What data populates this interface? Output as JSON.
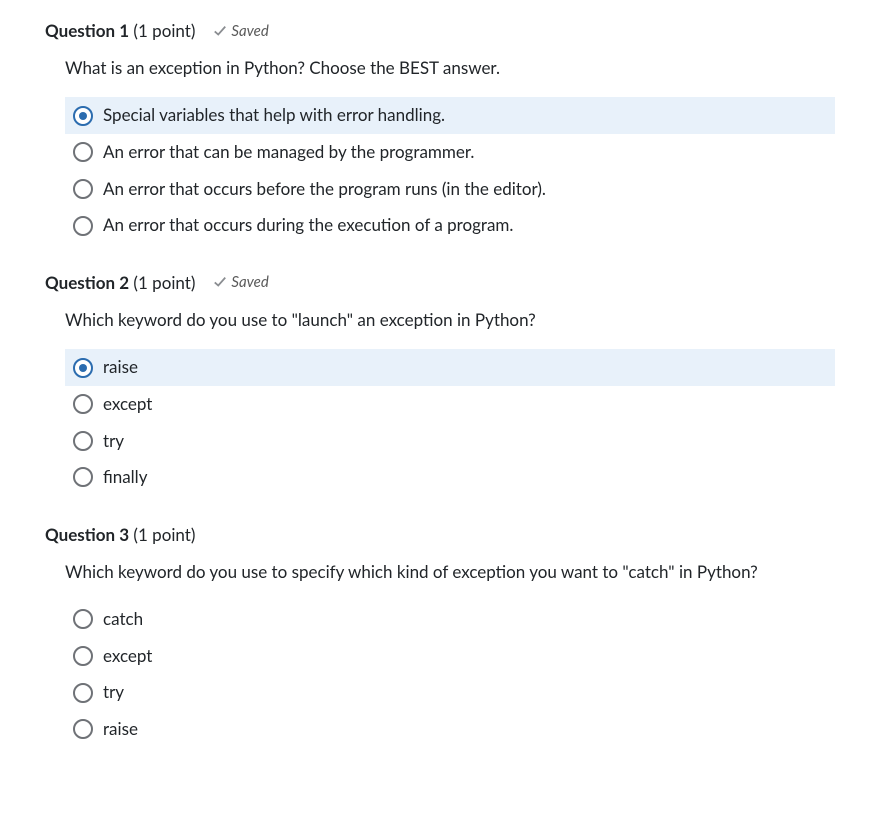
{
  "saved_label": "Saved",
  "questions": [
    {
      "number_label": "Question 1",
      "points_label": "(1 point)",
      "saved": true,
      "prompt": "What is an exception in Python? Choose the BEST answer.",
      "options": [
        {
          "label": "Special variables that help with error handling.",
          "selected": true
        },
        {
          "label": "An error that can be managed by the programmer.",
          "selected": false
        },
        {
          "label": "An error that occurs before the program runs (in the editor).",
          "selected": false
        },
        {
          "label": "An error that occurs during the execution of a program.",
          "selected": false
        }
      ]
    },
    {
      "number_label": "Question 2",
      "points_label": "(1 point)",
      "saved": true,
      "prompt": "Which keyword do you use to \"launch\" an exception in Python?",
      "options": [
        {
          "label": "raise",
          "selected": true
        },
        {
          "label": "except",
          "selected": false
        },
        {
          "label": "try",
          "selected": false
        },
        {
          "label": "finally",
          "selected": false
        }
      ]
    },
    {
      "number_label": "Question 3",
      "points_label": "(1 point)",
      "saved": false,
      "prompt": "Which keyword do you use to specify which kind of exception you want to \"catch\" in Python?",
      "options": [
        {
          "label": "catch",
          "selected": false
        },
        {
          "label": "except",
          "selected": false
        },
        {
          "label": "try",
          "selected": false
        },
        {
          "label": "raise",
          "selected": false
        }
      ]
    }
  ]
}
